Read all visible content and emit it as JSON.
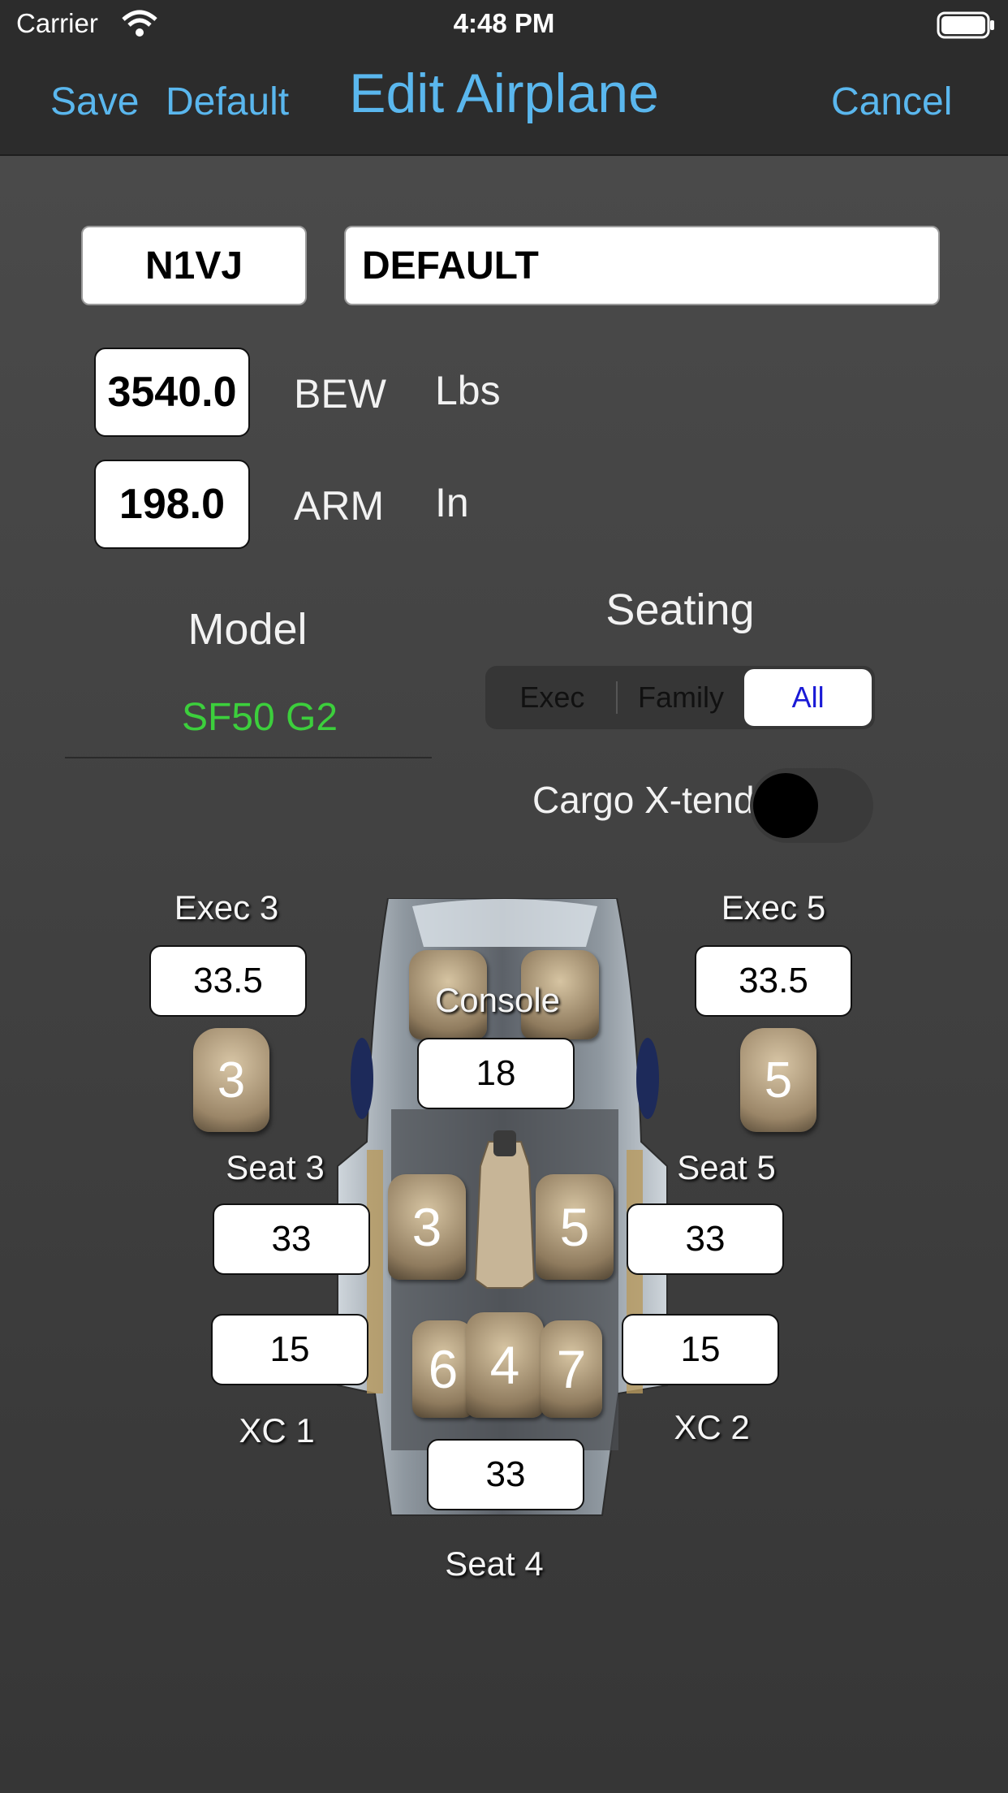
{
  "status_bar": {
    "carrier": "Carrier",
    "time": "4:48 PM"
  },
  "nav": {
    "save": "Save",
    "default": "Default",
    "title": "Edit Airplane",
    "cancel": "Cancel"
  },
  "tail_number": "N1VJ",
  "config_name": "DEFAULT",
  "bew": {
    "value": "3540.0",
    "label": "BEW",
    "unit": "Lbs"
  },
  "arm": {
    "value": "198.0",
    "label": "ARM",
    "unit": "In"
  },
  "model": {
    "label": "Model",
    "value": "SF50 G2"
  },
  "seating": {
    "label": "Seating",
    "options": [
      "Exec",
      "Family",
      "All"
    ],
    "selected": "All"
  },
  "cargo": {
    "label": "Cargo X-tend:",
    "on": false
  },
  "seats": {
    "exec3": {
      "label": "Exec 3",
      "value": "33.5",
      "icon": "3"
    },
    "exec5": {
      "label": "Exec 5",
      "value": "33.5",
      "icon": "5"
    },
    "console": {
      "label": "Console",
      "value": "18"
    },
    "seat3": {
      "label": "Seat 3",
      "value": "33"
    },
    "seat5": {
      "label": "Seat 5",
      "value": "33"
    },
    "xc1": {
      "label": "XC 1",
      "value": "15"
    },
    "xc2": {
      "label": "XC 2",
      "value": "15"
    },
    "seat4": {
      "label": "Seat 4",
      "value": "33"
    }
  },
  "cabin_seat_numbers": {
    "s3": "3",
    "s5": "5",
    "s6": "6",
    "s4": "4",
    "s7": "7"
  },
  "colors": {
    "accent": "#5ab7ee",
    "model_green": "#3ccf3c",
    "segment_selected_text": "#1a1ad6"
  }
}
